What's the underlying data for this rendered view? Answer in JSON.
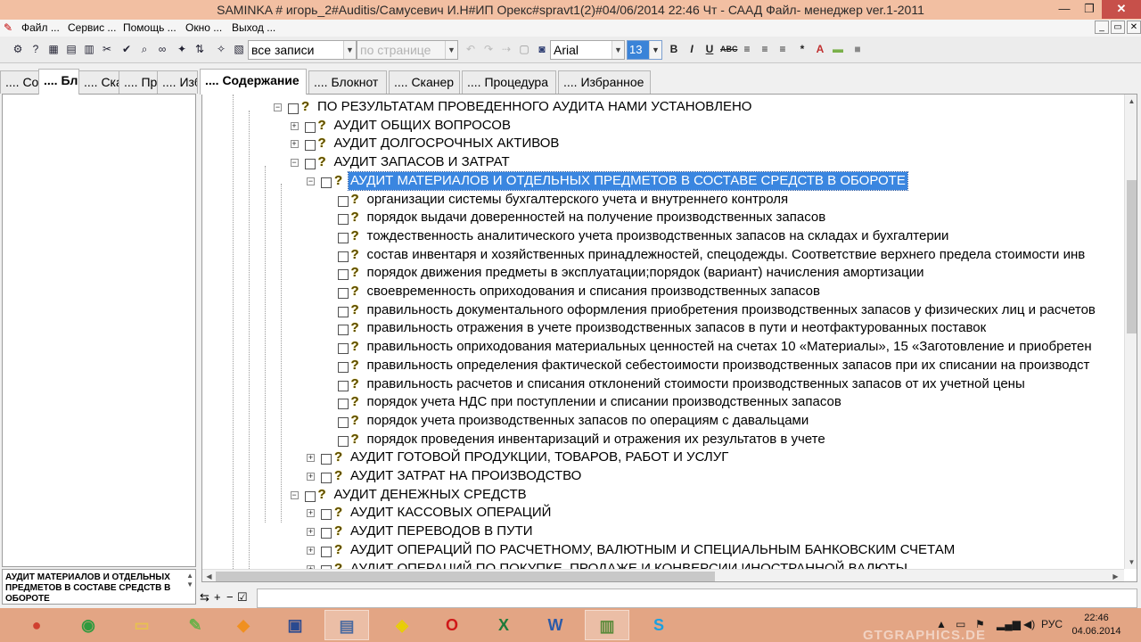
{
  "window": {
    "title": "SAMINKA # игорь_2#Auditis/Самусевич И.Н#ИП Орекс#spravt1(2)#04/06/2014 22:46 Чт - СААД Файл- менеджер ver.1-2011",
    "min_glyph": "—",
    "max_glyph": "❐",
    "close_glyph": "✕"
  },
  "menu": {
    "items": [
      "Файл ...",
      "Сервис ...",
      "Помощь ...",
      "Окно ...",
      "Выход ..."
    ],
    "mdi": [
      "_",
      "▭",
      "✕"
    ]
  },
  "toolbar": {
    "records_value": "все записи",
    "page_value": "по странице",
    "font_value": "Arial",
    "size_value": "13",
    "format_buttons": [
      "B",
      "I",
      "U",
      "ABC",
      "≡",
      "≡",
      "≡",
      "*",
      "A"
    ]
  },
  "left_tabs": [
    ".... Со",
    ".... Бл",
    ".... Ска",
    ".... Про",
    ".... Изб"
  ],
  "main_tabs": [
    ".... Содержание",
    ".... Блокнот",
    ".... Сканер",
    ".... Процедура",
    ".... Избранное"
  ],
  "left_panel": {
    "caption": "АУДИТ МАТЕРИАЛОВ И ОТДЕЛЬНЫХ ПРЕДМЕТОВ В СОСТАВЕ СРЕДСТВ В ОБОРОТЕ",
    "scroll_up": "▲",
    "scroll_down": "▼"
  },
  "bottom_tools": [
    "⇆",
    "+",
    "−",
    "☑"
  ],
  "tree": {
    "items": [
      {
        "text": "ПО РЕЗУЛЬТАТАМ ПРОВЕДЕННОГО АУДИТА НАМИ УСТАНОВЛЕНО",
        "expander": "−",
        "selected": false
      },
      {
        "text": "АУДИТ ОБЩИХ ВОПРОСОВ",
        "expander": "+",
        "selected": false
      },
      {
        "text": "АУДИТ ДОЛГОСРОЧНЫХ АКТИВОВ",
        "expander": "+",
        "selected": false
      },
      {
        "text": "АУДИТ ЗАПАСОВ И ЗАТРАТ",
        "expander": "−",
        "selected": false
      },
      {
        "text": "АУДИТ МАТЕРИАЛОВ И ОТДЕЛЬНЫХ ПРЕДМЕТОВ В СОСТАВЕ СРЕДСТВ В ОБОРОТЕ",
        "expander": "−",
        "selected": true
      },
      {
        "text": "организации системы бухгалтерского учета и внутреннего контроля",
        "expander": "",
        "selected": false
      },
      {
        "text": "порядок выдачи доверенностей на получение производственных запасов",
        "expander": "",
        "selected": false
      },
      {
        "text": "тождественность аналитического учета производственных запасов на складах и бухгалтерии",
        "expander": "",
        "selected": false
      },
      {
        "text": "состав инвентаря и хозяйственных принадлежностей, спецодежды. Соответствие верхнего предела стоимости инв",
        "expander": "",
        "selected": false
      },
      {
        "text": "порядок движения предметы в эксплуатации;порядок (вариант)  начисления амортизации",
        "expander": "",
        "selected": false
      },
      {
        "text": "своевременность оприходования и списания производственных запасов",
        "expander": "",
        "selected": false
      },
      {
        "text": "правильность документального оформления приобретения производственных запасов у физических лиц и расчетов",
        "expander": "",
        "selected": false
      },
      {
        "text": "правильность отражения в учете производственных запасов в пути и неотфактурованных поставок",
        "expander": "",
        "selected": false
      },
      {
        "text": "правильность оприходования материальных ценностей на счетах 10 «Материалы», 15 «Заготовление и приобретен",
        "expander": "",
        "selected": false
      },
      {
        "text": "правильность определения фактической себестоимости производственных запасов  при их списании на производст",
        "expander": "",
        "selected": false
      },
      {
        "text": "правильность расчетов  и  списания  отклонений стоимости производственных запасов  от их учетной цены",
        "expander": "",
        "selected": false
      },
      {
        "text": "порядок учета НДС при поступлении и списании производственных запасов",
        "expander": "",
        "selected": false
      },
      {
        "text": "порядок учета производственных запасов по операциям с давальцами",
        "expander": "",
        "selected": false
      },
      {
        "text": "порядок проведения инвентаризаций и отражения их результатов в учете",
        "expander": "",
        "selected": false
      },
      {
        "text": "АУДИТ ГОТОВОЙ ПРОДУКЦИИ, ТОВАРОВ, РАБОТ И УСЛУГ",
        "expander": "+",
        "selected": false
      },
      {
        "text": "АУДИТ ЗАТРАТ НА ПРОИЗВОДСТВО",
        "expander": "+",
        "selected": false
      },
      {
        "text": "АУДИТ ДЕНЕЖНЫХ СРЕДСТВ",
        "expander": "−",
        "selected": false
      },
      {
        "text": "АУДИТ КАССОВЫХ ОПЕРАЦИЙ",
        "expander": "+",
        "selected": false
      },
      {
        "text": "АУДИТ ПЕРЕВОДОВ В ПУТИ",
        "expander": "+",
        "selected": false
      },
      {
        "text": "АУДИТ ОПЕРАЦИЙ ПО РАСЧЕТНОМУ, ВАЛЮТНЫМ И СПЕЦИАЛЬНЫМ БАНКОВСКИМ СЧЕТАМ",
        "expander": "+",
        "selected": false
      },
      {
        "text": "АУДИТ ОПЕРАЦИЙ ПО ПОКУПКЕ, ПРОДАЖЕ И КОНВЕРСИИ ИНОСТРАННОЙ ВАЛЮТЫ",
        "expander": "+",
        "selected": false
      }
    ]
  },
  "scrollbars": {
    "up": "▲",
    "down": "▼",
    "left": "◀",
    "right": "▶"
  },
  "taskbar": {
    "apps": [
      {
        "icon": "chrome-ball-icon",
        "glyph": "●",
        "color": "#d04030"
      },
      {
        "icon": "chrome-icon",
        "glyph": "◉",
        "color": "#2f9a3e"
      },
      {
        "icon": "folder-icon",
        "glyph": "▭",
        "color": "#e8c050"
      },
      {
        "icon": "notepad-icon",
        "glyph": "✎",
        "color": "#6bb04a"
      },
      {
        "icon": "fox-icon",
        "glyph": "◆",
        "color": "#f09020"
      },
      {
        "icon": "floppy-icon",
        "glyph": "▣",
        "color": "#2a4a90"
      },
      {
        "icon": "computer-icon",
        "glyph": "▤",
        "color": "#4a6aa0"
      },
      {
        "icon": "diamond-icon",
        "glyph": "◈",
        "color": "#e8d000"
      },
      {
        "icon": "opera-icon",
        "glyph": "O",
        "color": "#d01818"
      },
      {
        "icon": "excel-icon",
        "glyph": "X",
        "color": "#1e7a3a"
      },
      {
        "icon": "word-icon",
        "glyph": "W",
        "color": "#2a5aa8"
      },
      {
        "icon": "books-icon",
        "glyph": "▥",
        "color": "#5a8a3a"
      },
      {
        "icon": "skype-icon",
        "glyph": "S",
        "color": "#1aa0e0"
      }
    ],
    "tray": {
      "expand": "▲",
      "lang": "РУС",
      "flag": "⚑"
    },
    "clock_time": "22:46",
    "clock_date": "04.06.2014"
  }
}
